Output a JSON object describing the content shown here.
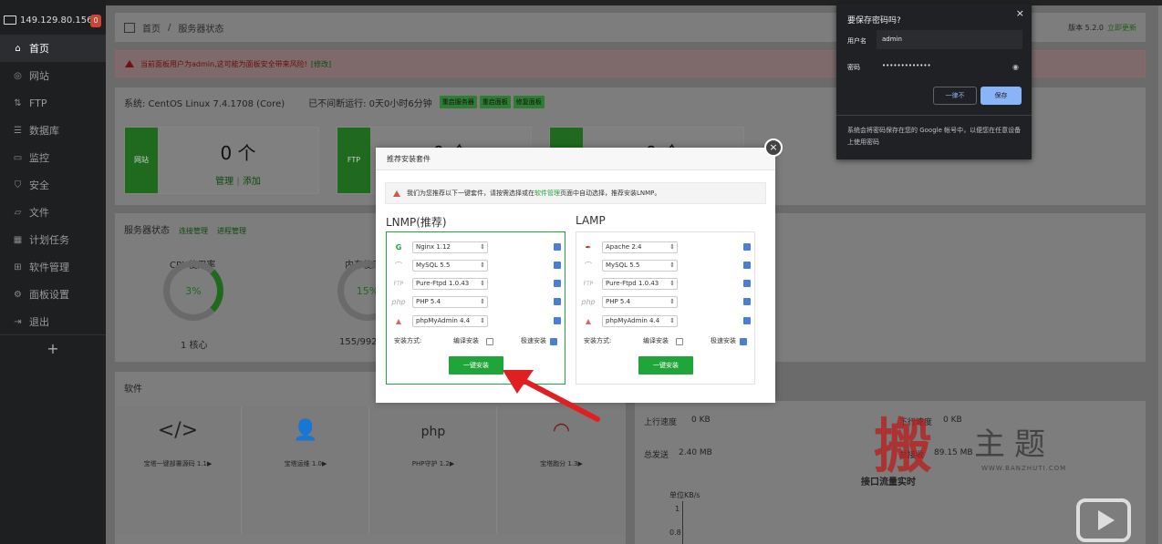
{
  "sidebar": {
    "ip": "149.129.80.156",
    "badge": "0",
    "items": [
      {
        "label": "首页",
        "icon": "home-icon"
      },
      {
        "label": "网站",
        "icon": "globe-icon"
      },
      {
        "label": "FTP",
        "icon": "ftp-icon"
      },
      {
        "label": "数据库",
        "icon": "database-icon"
      },
      {
        "label": "监控",
        "icon": "monitor-icon"
      },
      {
        "label": "安全",
        "icon": "shield-icon"
      },
      {
        "label": "文件",
        "icon": "folder-icon"
      },
      {
        "label": "计划任务",
        "icon": "calendar-icon"
      },
      {
        "label": "软件管理",
        "icon": "apps-icon"
      },
      {
        "label": "面板设置",
        "icon": "gear-icon"
      },
      {
        "label": "退出",
        "icon": "logout-icon"
      }
    ],
    "add": "+"
  },
  "breadcrumb": {
    "home": "首页",
    "current": "服务器状态",
    "sep": "/"
  },
  "version": {
    "label": "版本 5.2.0",
    "update": "立即更新"
  },
  "alert": {
    "text": "当前面板用户为admin,这可能为面板安全带来风险!",
    "fix": "[修改]"
  },
  "system": {
    "os": "系统: CentOS Linux 7.4.1708 (Core)",
    "uptime": "已不间断运行: 0天0小时6分钟",
    "buttons": [
      "重启服务器",
      "重启面板",
      "修复面板"
    ]
  },
  "stats": [
    {
      "label": "网站",
      "value": "0 个",
      "manage": "管理",
      "sep": "|",
      "add": "添加"
    },
    {
      "label": "FTP",
      "value": "0 个"
    },
    {
      "label": "",
      "value": "0 个"
    }
  ],
  "server_status": {
    "title": "服务器状态",
    "conn": "连接管理",
    "proc": "进程管理",
    "cpu_title": "CPU使用率",
    "cpu_value": "3%",
    "cpu_cores": "1 核心",
    "mem_title": "内存使用",
    "mem_value": "15%",
    "mem_detail": "155/992"
  },
  "software": {
    "title": "软件",
    "items": [
      {
        "icon": "code-icon",
        "glyph": "</>",
        "name": "宝塔一键部署源码 1.1▶"
      },
      {
        "icon": "operator-icon",
        "glyph": "👤",
        "name": "宝塔运维 1.0▶"
      },
      {
        "icon": "php-guard-icon",
        "glyph": "php",
        "name": "PHP守护 1.2▶"
      },
      {
        "icon": "speedometer-icon",
        "glyph": "◠",
        "name": "宝塔跑分 1.3▶"
      }
    ]
  },
  "network": {
    "up_label": "上行速度",
    "up_value": "0 KB",
    "down_label": "下行速度",
    "down_value": "0 KB",
    "sent_label": "总发送",
    "sent_value": "2.40 MB",
    "recv_label": "总接收",
    "recv_value": "89.15 MB",
    "chart_title": "接口流量实时",
    "unit": "单位KB/s",
    "ticks": [
      "1",
      "0.8"
    ]
  },
  "dialog": {
    "title": "推荐安装套件",
    "close": "×",
    "note_prefix": "我们为您推荐以下一键套件，请按需选择或在",
    "note_link": "软件管理",
    "note_suffix": "页面中自动选择，推荐安装LNMP。",
    "lnmp": {
      "title": "LNMP(推荐)",
      "rows": [
        {
          "icon": "nginx-icon",
          "glyph": "G",
          "value": "Nginx 1.12"
        },
        {
          "icon": "mysql-icon",
          "glyph": "⌒",
          "value": "MySQL 5.5"
        },
        {
          "icon": "ftpd-icon",
          "glyph": "FTP",
          "value": "Pure-Ftpd 1.0.43"
        },
        {
          "icon": "php-icon",
          "glyph": "php",
          "value": "PHP 5.4"
        },
        {
          "icon": "phpmyadmin-icon",
          "glyph": "▲",
          "value": "phpMyAdmin 4.4"
        }
      ],
      "method_label": "安装方式:",
      "compile": "编译安装",
      "fast": "极速安装",
      "install": "一键安装"
    },
    "lamp": {
      "title": "LAMP",
      "rows": [
        {
          "icon": "apache-icon",
          "glyph": "✒",
          "value": "Apache 2.4"
        },
        {
          "icon": "mysql-icon",
          "glyph": "⌒",
          "value": "MySQL 5.5"
        },
        {
          "icon": "ftpd-icon",
          "glyph": "FTP",
          "value": "Pure-Ftpd 1.0.43"
        },
        {
          "icon": "php-icon",
          "glyph": "php",
          "value": "PHP 5.4"
        },
        {
          "icon": "phpmyadmin-icon",
          "glyph": "▲",
          "value": "phpMyAdmin 4.4"
        }
      ],
      "method_label": "安装方式:",
      "compile": "编译安装",
      "fast": "极速安装",
      "install": "一键安装"
    }
  },
  "password_popup": {
    "title": "要保存密码吗?",
    "close": "×",
    "user_label": "用户名",
    "user_value": "admin",
    "pass_label": "密码",
    "pass_value": "•••••••••••••",
    "never": "一律不",
    "save": "保存",
    "footer": "系统会将密码保存在您的 Google 帐号中，以便您在任意设备上使用密码"
  },
  "watermark": {
    "seal": "搬",
    "text": "主题",
    "url": "WWW.BANZHUTI.COM"
  },
  "colors": {
    "green": "#20a53a",
    "arrow": "#e02020",
    "popup_bg": "#202124"
  }
}
